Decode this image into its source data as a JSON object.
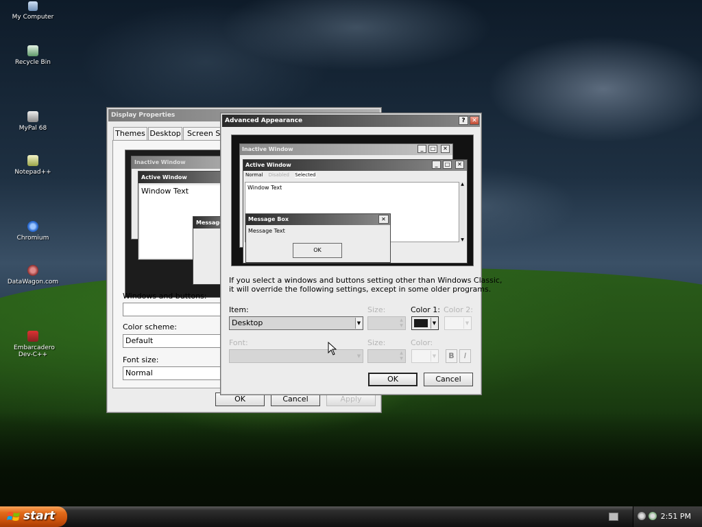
{
  "desktop_icons": [
    {
      "label": "My Computer"
    },
    {
      "label": "Recycle Bin"
    },
    {
      "label": "MyPal 68"
    },
    {
      "label": "Notepad++"
    },
    {
      "label": "Chromium"
    },
    {
      "label": "DataWagon.com"
    },
    {
      "label": "Embarcadero Dev-C++"
    }
  ],
  "display_properties": {
    "title": "Display Properties",
    "tabs": [
      "Themes",
      "Desktop",
      "Screen Sa"
    ],
    "preview": {
      "inactive_title": "Inactive Window",
      "active_title": "Active Window",
      "window_text": "Window Text",
      "message_title": "Message"
    },
    "windows_and_buttons_label": "Windows and buttons:",
    "windows_and_buttons_value": "",
    "color_scheme_label": "Color scheme:",
    "color_scheme_value": "Default",
    "font_size_label": "Font size:",
    "font_size_value": "Normal",
    "ok": "OK",
    "cancel": "Cancel",
    "apply": "Apply"
  },
  "advanced_appearance": {
    "title": "Advanced Appearance",
    "help_glyph": "?",
    "close_glyph": "✕",
    "preview": {
      "inactive_title": "Inactive Window",
      "active_title": "Active Window",
      "menu_normal": "Normal",
      "menu_disabled": "Disabled",
      "menu_selected": "Selected",
      "window_text": "Window Text",
      "msgbox_title": "Message Box",
      "msgbox_text": "Message Text",
      "msgbox_ok": "OK"
    },
    "info_text_line1": "If you select a windows and buttons setting other than Windows Classic,",
    "info_text_line2": "it will override the following settings, except in some older programs.",
    "item_label": "Item:",
    "item_value": "Desktop",
    "size_label": "Size:",
    "color1_label": "Color 1:",
    "color2_label": "Color 2:",
    "font_label": "Font:",
    "font_size_label": "Size:",
    "font_color_label": "Color:",
    "bold_glyph": "B",
    "italic_glyph": "I",
    "ok": "OK",
    "cancel": "Cancel",
    "color1_swatch": "#1a1a1a"
  },
  "taskbar": {
    "start_label": "start",
    "clock": "2:51 PM"
  }
}
